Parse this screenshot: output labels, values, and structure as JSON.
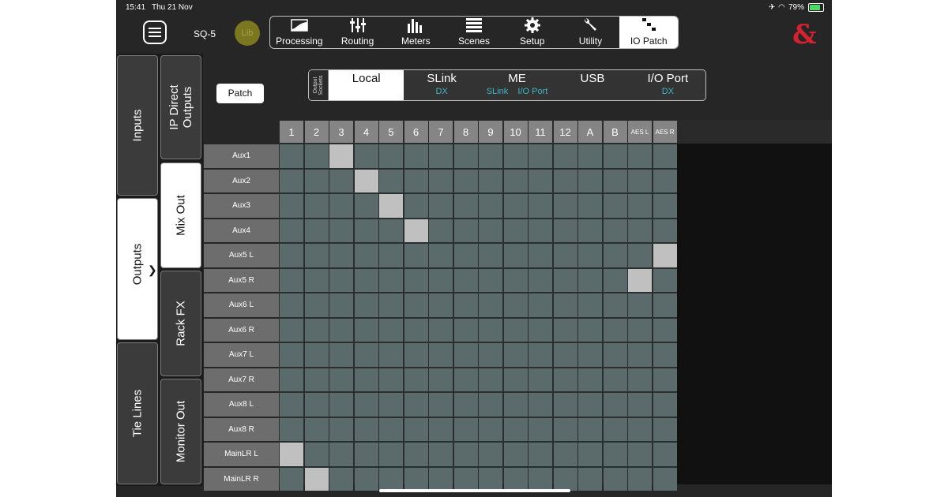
{
  "status_bar": {
    "time": "15:41",
    "date": "Thu 21 Nov",
    "battery": "79%"
  },
  "header": {
    "device": "SQ-5",
    "library_label": "Lib",
    "tabs": [
      {
        "label": "Processing",
        "icon": "processing-icon"
      },
      {
        "label": "Routing",
        "icon": "routing-icon"
      },
      {
        "label": "Meters",
        "icon": "meters-icon"
      },
      {
        "label": "Scenes",
        "icon": "scenes-icon"
      },
      {
        "label": "Setup",
        "icon": "gear-icon"
      },
      {
        "label": "Utility",
        "icon": "wrench-icon"
      },
      {
        "label": "IO Patch",
        "icon": "io-patch-icon",
        "active": true
      }
    ],
    "brand_mark": "&",
    "brand_color": "#d52230"
  },
  "left_nav": {
    "primary": [
      {
        "label": "Inputs"
      },
      {
        "label": "Outputs",
        "active": true,
        "chevron": "❯"
      },
      {
        "label": "Tie Lines"
      }
    ],
    "secondary": [
      {
        "label": "IP Direct Outputs"
      },
      {
        "label": "Mix Out",
        "active": true
      },
      {
        "label": "Rack FX"
      },
      {
        "label": "Monitor Out"
      }
    ]
  },
  "patch_button": "Patch",
  "sockets": {
    "label": "Output Sockets",
    "tabs": [
      {
        "label": "Local",
        "sub": "",
        "active": true
      },
      {
        "label": "SLink",
        "sub": "DX"
      },
      {
        "label": "ME",
        "sub": "SLink    I/O Port"
      },
      {
        "label": "USB",
        "sub": ""
      },
      {
        "label": "I/O Port",
        "sub": "DX"
      }
    ]
  },
  "grid": {
    "columns": [
      "1",
      "2",
      "3",
      "4",
      "5",
      "6",
      "7",
      "8",
      "9",
      "10",
      "11",
      "12",
      "A",
      "B",
      "AES L",
      "AES R"
    ],
    "rows": [
      "Aux1",
      "Aux2",
      "Aux3",
      "Aux4",
      "Aux5 L",
      "Aux5 R",
      "Aux6 L",
      "Aux6 R",
      "Aux7 L",
      "Aux7 R",
      "Aux8 L",
      "Aux8 R",
      "MainLR L",
      "MainLR R"
    ],
    "patched": [
      [
        0,
        2
      ],
      [
        1,
        3
      ],
      [
        2,
        4
      ],
      [
        3,
        5
      ],
      [
        4,
        15
      ],
      [
        5,
        14
      ],
      [
        12,
        0
      ],
      [
        13,
        1
      ]
    ],
    "cell_color": "#5b6a6a",
    "patched_color": "#c0c0c0"
  }
}
